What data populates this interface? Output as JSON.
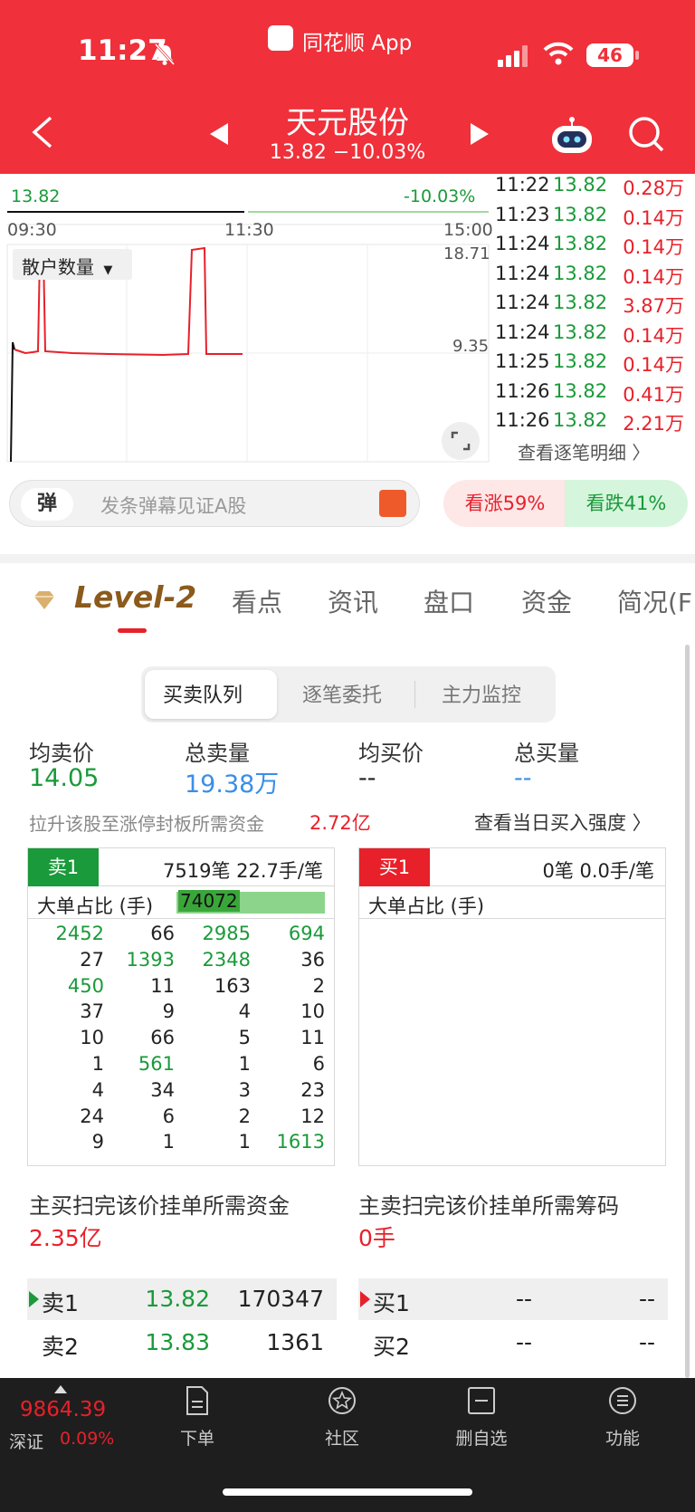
{
  "status_bar": {
    "time": "11:27",
    "app_name": "同花顺 App",
    "battery": "46"
  },
  "header": {
    "stock_name": "天元股份",
    "price_change": "13.82 −10.03%"
  },
  "chart": {
    "price_label": "13.82",
    "pct_label": "-10.03%",
    "time_labels": [
      "09:30",
      "11:30",
      "15:00"
    ],
    "right_labels": [
      "18.71",
      "9.35"
    ],
    "indicator_label": "散户数量"
  },
  "ticks": {
    "rows": [
      {
        "time": "11:22",
        "price": "13.82",
        "volume": "0.28万"
      },
      {
        "time": "11:23",
        "price": "13.82",
        "volume": "0.14万"
      },
      {
        "time": "11:24",
        "price": "13.82",
        "volume": "0.14万"
      },
      {
        "time": "11:24",
        "price": "13.82",
        "volume": "0.14万"
      },
      {
        "time": "11:24",
        "price": "13.82",
        "volume": "3.87万"
      },
      {
        "time": "11:24",
        "price": "13.82",
        "volume": "0.14万"
      },
      {
        "time": "11:25",
        "price": "13.82",
        "volume": "0.14万"
      },
      {
        "time": "11:26",
        "price": "13.82",
        "volume": "0.41万"
      },
      {
        "time": "11:26",
        "price": "13.82",
        "volume": "2.21万"
      }
    ],
    "detail_link": "查看逐笔明细 〉"
  },
  "barrage": {
    "icon_text": "弹",
    "placeholder": "发条弹幕见证A股"
  },
  "sentiment": {
    "rise": "看涨59%",
    "fall": "看跌41%"
  },
  "tabs": [
    "Level-2",
    "看点",
    "资讯",
    "盘口",
    "资金",
    "简况(F"
  ],
  "segments": [
    "买卖队列",
    "逐笔委托",
    "主力监控"
  ],
  "stats": {
    "avg_sell_label": "均卖价",
    "avg_sell_value": "14.05",
    "total_sell_label": "总卖量",
    "total_sell_value": "19.38万",
    "avg_buy_label": "均买价",
    "avg_buy_value": "--",
    "total_buy_label": "总买量",
    "total_buy_value": "--"
  },
  "limit_up": {
    "note": "拉升该股至涨停封板所需资金",
    "value": "2.72亿",
    "link": "查看当日买入强度 〉"
  },
  "sell_queue": {
    "tag": "卖1",
    "info": "7519笔   22.7手/笔",
    "big_label": "大单占比 (手)",
    "big_value": "74072",
    "rows": [
      [
        {
          "v": "2452",
          "g": true
        },
        {
          "v": "66",
          "g": false
        },
        {
          "v": "2985",
          "g": true
        },
        {
          "v": "694",
          "g": true
        }
      ],
      [
        {
          "v": "27",
          "g": false
        },
        {
          "v": "1393",
          "g": true
        },
        {
          "v": "2348",
          "g": true
        },
        {
          "v": "36",
          "g": false
        }
      ],
      [
        {
          "v": "450",
          "g": true
        },
        {
          "v": "11",
          "g": false
        },
        {
          "v": "163",
          "g": false
        },
        {
          "v": "2",
          "g": false
        }
      ],
      [
        {
          "v": "37",
          "g": false
        },
        {
          "v": "9",
          "g": false
        },
        {
          "v": "4",
          "g": false
        },
        {
          "v": "10",
          "g": false
        }
      ],
      [
        {
          "v": "10",
          "g": false
        },
        {
          "v": "66",
          "g": false
        },
        {
          "v": "5",
          "g": false
        },
        {
          "v": "11",
          "g": false
        }
      ],
      [
        {
          "v": "1",
          "g": false
        },
        {
          "v": "561",
          "g": true
        },
        {
          "v": "1",
          "g": false
        },
        {
          "v": "6",
          "g": false
        }
      ],
      [
        {
          "v": "4",
          "g": false
        },
        {
          "v": "34",
          "g": false
        },
        {
          "v": "3",
          "g": false
        },
        {
          "v": "23",
          "g": false
        }
      ],
      [
        {
          "v": "24",
          "g": false
        },
        {
          "v": "6",
          "g": false
        },
        {
          "v": "2",
          "g": false
        },
        {
          "v": "12",
          "g": false
        }
      ],
      [
        {
          "v": "9",
          "g": false
        },
        {
          "v": "1",
          "g": false
        },
        {
          "v": "1",
          "g": false
        },
        {
          "v": "1613",
          "g": true
        }
      ]
    ]
  },
  "buy_queue": {
    "tag": "买1",
    "info": "0笔   0.0手/笔",
    "big_label": "大单占比 (手)"
  },
  "required": {
    "buy_label": "主买扫完该价挂单所需资金",
    "buy_value": "2.35亿",
    "sell_label": "主卖扫完该价挂单所需筹码",
    "sell_value": "0手"
  },
  "order_book": {
    "sell": [
      {
        "label": "卖1",
        "price": "13.82",
        "volume": "170347"
      },
      {
        "label": "卖2",
        "price": "13.83",
        "volume": "1361"
      }
    ],
    "buy": [
      {
        "label": "买1",
        "price": "--",
        "volume": "--"
      },
      {
        "label": "买2",
        "price": "--",
        "volume": "--"
      }
    ]
  },
  "bottom_bar": {
    "index_value": "9864.39",
    "index_name": "深证",
    "index_pct": "0.09%",
    "nav": [
      "下单",
      "社区",
      "删自选",
      "功能"
    ]
  },
  "colors": {
    "brand_red": "#f0303a",
    "up_red": "#e8202a",
    "down_green": "#1a9a3a",
    "blue": "#3a8ee8"
  }
}
